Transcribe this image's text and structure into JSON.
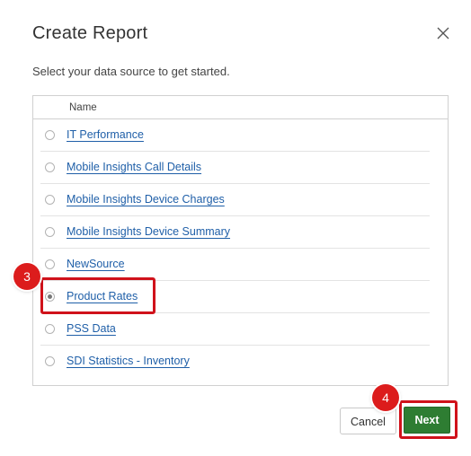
{
  "dialog": {
    "title": "Create Report",
    "subtitle": "Select your data source to get started.",
    "close_icon": "close-icon"
  },
  "table": {
    "header": "Name",
    "rows": [
      {
        "label": "IT Performance",
        "selected": false
      },
      {
        "label": "Mobile Insights Call Details",
        "selected": false
      },
      {
        "label": "Mobile Insights Device Charges",
        "selected": false
      },
      {
        "label": "Mobile Insights Device Summary",
        "selected": false
      },
      {
        "label": "NewSource",
        "selected": false
      },
      {
        "label": "Product Rates",
        "selected": true
      },
      {
        "label": "PSS Data",
        "selected": false
      },
      {
        "label": "SDI Statistics - Inventory",
        "selected": false
      }
    ]
  },
  "annotations": {
    "step_3": "3",
    "step_4": "4",
    "highlight_color": "#d0121b",
    "badge_color": "#dc1c1c"
  },
  "buttons": {
    "cancel_label": "Cancel",
    "next_label": "Next",
    "next_color": "#2e7d32"
  }
}
